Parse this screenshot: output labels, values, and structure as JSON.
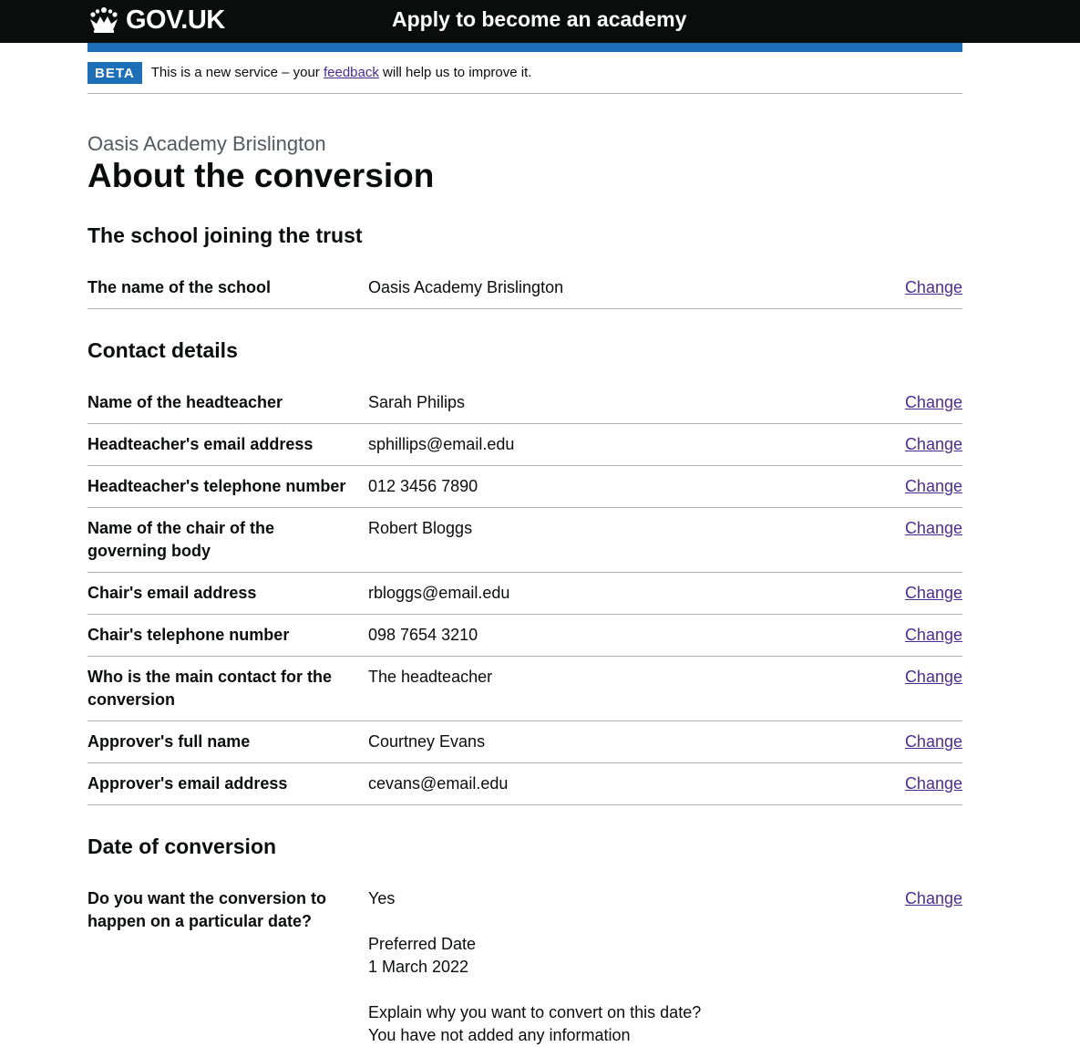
{
  "header": {
    "logo_text": "GOV.UK",
    "service_name": "Apply to become an academy"
  },
  "phase_banner": {
    "tag": "BETA",
    "text_before": "This is a new service – your ",
    "link": "feedback",
    "text_after": " will help us to improve it."
  },
  "page": {
    "caption": "Oasis Academy Brislington",
    "title": "About the conversion"
  },
  "sections": {
    "school": {
      "heading": "The school joining the trust",
      "rows": [
        {
          "key": "The name of the school",
          "value": "Oasis Academy Brislington",
          "action": "Change"
        }
      ]
    },
    "contact": {
      "heading": "Contact details",
      "rows": [
        {
          "key": "Name of the headteacher",
          "value": "Sarah Philips",
          "action": "Change"
        },
        {
          "key": "Headteacher's email address",
          "value": "sphillips@email.edu",
          "action": "Change"
        },
        {
          "key": "Headteacher's telephone number",
          "value": "012 3456 7890",
          "action": "Change"
        },
        {
          "key": "Name of the chair of the governing body",
          "value": "Robert Bloggs",
          "action": "Change"
        },
        {
          "key": "Chair's email address",
          "value": "rbloggs@email.edu",
          "action": "Change"
        },
        {
          "key": "Chair's telephone number",
          "value": "098 7654 3210",
          "action": "Change"
        },
        {
          "key": "Who is the main contact for the conversion",
          "value": "The headteacher",
          "action": "Change"
        },
        {
          "key": "Approver's full name",
          "value": "Courtney Evans",
          "action": "Change"
        },
        {
          "key": "Approver's email address",
          "value": "cevans@email.edu",
          "action": "Change"
        }
      ]
    },
    "date": {
      "heading": "Date of conversion",
      "rows": [
        {
          "key": "Do you want the conversion to happen on a particular date?",
          "value": "Yes",
          "preferred_label": "Preferred Date",
          "preferred_value": "1 March 2022",
          "reason_label": "Explain why you want to convert on this date?",
          "reason_value": "You have not added any information",
          "action": "Change"
        }
      ]
    }
  }
}
